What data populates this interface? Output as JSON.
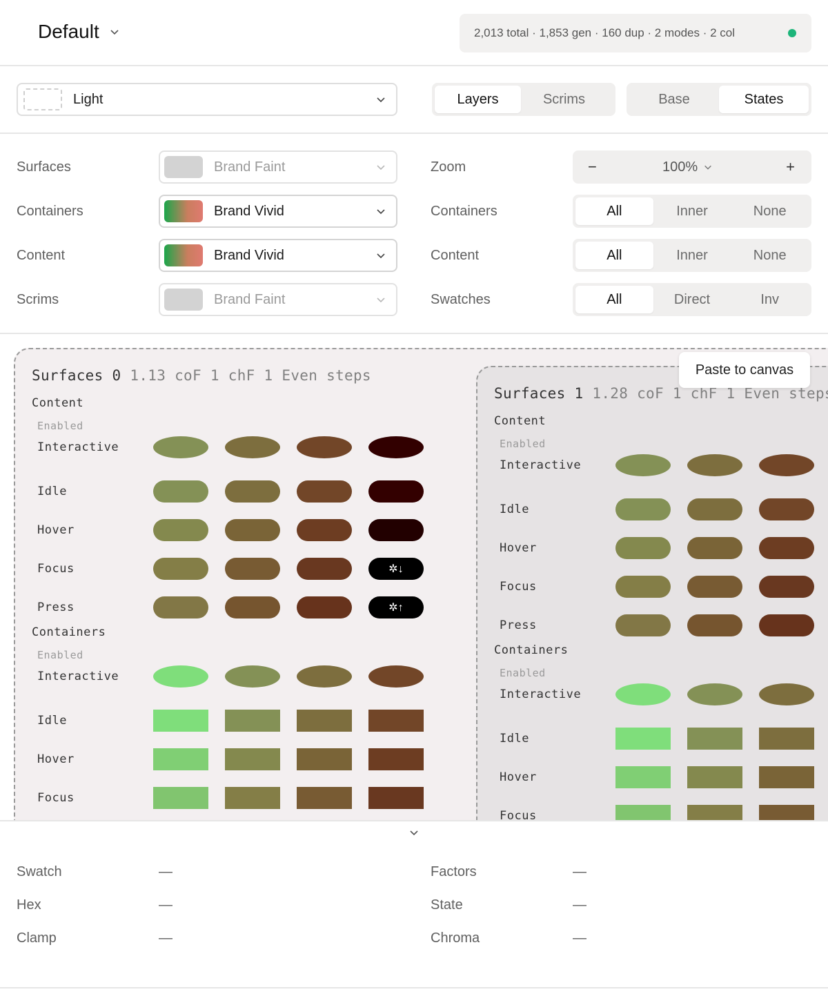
{
  "header": {
    "title": "Default",
    "stats": "2,013 total · 1,853 gen · 160 dup · 2 modes · 2 col",
    "status_color": "#1db57a"
  },
  "toolbar": {
    "theme": "Light",
    "view_tabs": [
      {
        "label": "Layers",
        "active": true
      },
      {
        "label": "Scrims",
        "active": false
      }
    ],
    "mode_tabs": [
      {
        "label": "Base",
        "active": false
      },
      {
        "label": "States",
        "active": true
      }
    ]
  },
  "controls": {
    "left": [
      {
        "label": "Surfaces",
        "value": "Brand Faint",
        "swatch": "gray",
        "enabled": false
      },
      {
        "label": "Containers",
        "value": "Brand Vivid",
        "swatch": "gradient",
        "enabled": true
      },
      {
        "label": "Content",
        "value": "Brand Vivid",
        "swatch": "gradient",
        "enabled": true
      },
      {
        "label": "Scrims",
        "value": "Brand Faint",
        "swatch": "gray",
        "enabled": false
      }
    ],
    "zoom": {
      "label": "Zoom",
      "minus": "−",
      "value": "100%",
      "plus": "+"
    },
    "right": [
      {
        "label": "Containers",
        "options": [
          "All",
          "Inner",
          "None"
        ],
        "active": 0
      },
      {
        "label": "Content",
        "options": [
          "All",
          "Inner",
          "None"
        ],
        "active": 0
      },
      {
        "label": "Swatches",
        "options": [
          "All",
          "Direct",
          "Inv"
        ],
        "active": 0
      }
    ]
  },
  "canvas": {
    "paste_label": "Paste to canvas",
    "panels": [
      {
        "name": "Surfaces 0",
        "meta": "1.13  coF  1  chF  1  Even steps",
        "sections": [
          {
            "title": "Content",
            "state_header": "Enabled",
            "rows": [
              {
                "label": "Interactive",
                "shape": "ell",
                "colors": [
                  "#849156",
                  "#7d6e3e",
                  "#724628",
                  "#320000"
                ]
              },
              {
                "label": "Idle",
                "shape": "pill",
                "colors": [
                  "#849156",
                  "#7d6e3e",
                  "#724628",
                  "#330000"
                ]
              },
              {
                "label": "Hover",
                "shape": "pill",
                "colors": [
                  "#84894e",
                  "#7a6437",
                  "#6d3d22",
                  "#220000"
                ]
              },
              {
                "label": "Focus",
                "shape": "pill",
                "colors": [
                  "#847e47",
                  "#785b33",
                  "#693820",
                  "#000000"
                ],
                "glyph": "✲↓"
              },
              {
                "label": "Press",
                "shape": "pill",
                "colors": [
                  "#827746",
                  "#76552f",
                  "#67331c",
                  "#000000"
                ],
                "glyph": "✲↑"
              }
            ]
          },
          {
            "title": "Containers",
            "state_header": "Enabled",
            "rows": [
              {
                "label": "Interactive",
                "shape": "ell",
                "colors": [
                  "#7fde7b",
                  "#849156",
                  "#7d6e3e",
                  "#724628"
                ]
              },
              {
                "label": "Idle",
                "shape": "rect",
                "colors": [
                  "#7fde7b",
                  "#849156",
                  "#7d6e3e",
                  "#724628"
                ]
              },
              {
                "label": "Hover",
                "shape": "rect",
                "colors": [
                  "#80cf74",
                  "#84894e",
                  "#7a6437",
                  "#6d3d22"
                ]
              },
              {
                "label": "Focus",
                "shape": "rect",
                "colors": [
                  "#81c56f",
                  "#847e47",
                  "#785b33",
                  "#693820"
                ]
              }
            ]
          }
        ]
      },
      {
        "name": "Surfaces 1",
        "meta": "1.28  coF  1  chF  1  Even steps",
        "sections": [
          {
            "title": "Content",
            "state_header": "Enabled",
            "rows": [
              {
                "label": "Interactive",
                "shape": "ell",
                "colors": [
                  "#849156",
                  "#7d6e3e",
                  "#724628"
                ]
              },
              {
                "label": "Idle",
                "shape": "pill",
                "colors": [
                  "#849156",
                  "#7d6e3e",
                  "#724628"
                ]
              },
              {
                "label": "Hover",
                "shape": "pill",
                "colors": [
                  "#84894e",
                  "#7a6437",
                  "#6d3d22"
                ]
              },
              {
                "label": "Focus",
                "shape": "pill",
                "colors": [
                  "#847e47",
                  "#785b33",
                  "#693820"
                ]
              },
              {
                "label": "Press",
                "shape": "pill",
                "colors": [
                  "#827746",
                  "#76552f",
                  "#67331c"
                ]
              }
            ]
          },
          {
            "title": "Containers",
            "state_header": "Enabled",
            "rows": [
              {
                "label": "Interactive",
                "shape": "ell",
                "colors": [
                  "#7fde7b",
                  "#849156",
                  "#7d6e3e"
                ]
              },
              {
                "label": "Idle",
                "shape": "rect",
                "colors": [
                  "#7fde7b",
                  "#849156",
                  "#7d6e3e"
                ]
              },
              {
                "label": "Hover",
                "shape": "rect",
                "colors": [
                  "#80cf74",
                  "#84894e",
                  "#7a6437"
                ]
              },
              {
                "label": "Focus",
                "shape": "rect",
                "colors": [
                  "#81c56f",
                  "#847e47",
                  "#785b33"
                ]
              }
            ]
          }
        ]
      }
    ]
  },
  "info": {
    "left": [
      {
        "label": "Swatch",
        "value": "—"
      },
      {
        "label": "Hex",
        "value": "—"
      },
      {
        "label": "Clamp",
        "value": "—"
      }
    ],
    "right": [
      {
        "label": "Factors",
        "value": "—"
      },
      {
        "label": "State",
        "value": "—"
      },
      {
        "label": "Chroma",
        "value": "—"
      }
    ]
  }
}
